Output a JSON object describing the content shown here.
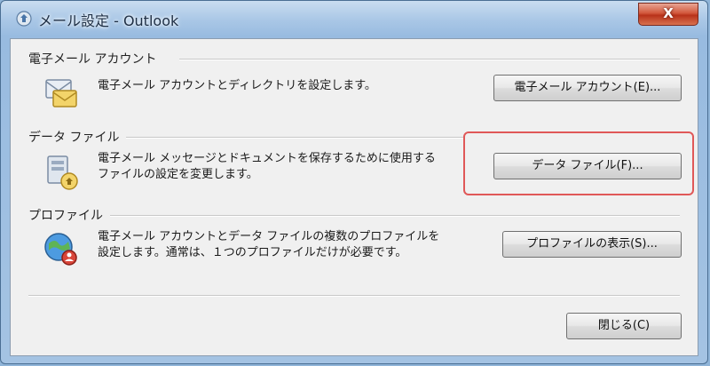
{
  "window": {
    "title": "メール設定 - Outlook",
    "close_label": "X"
  },
  "sections": {
    "accounts": {
      "label": "電子メール アカウント",
      "description": "電子メール アカウントとディレクトリを設定します。",
      "button_label": "電子メール アカウント(E)...",
      "icon": "mail-accounts-icon"
    },
    "data_files": {
      "label": "データ ファイル",
      "description_line1": "電子メール メッセージとドキュメントを保存するために使用する",
      "description_line2": "ファイルの設定を変更します。",
      "button_label": "データ ファイル(F)...",
      "icon": "data-file-icon",
      "highlight_color": "#e05858"
    },
    "profiles": {
      "label": "プロファイル",
      "description_line1": "電子メール アカウントとデータ ファイルの複数のプロファイルを",
      "description_line2": "設定します。通常は、１つのプロファイルだけが必要です。",
      "button_label": "プロファイルの表示(S)...",
      "icon": "profile-globe-icon"
    }
  },
  "footer": {
    "close_button_label": "閉じる(C)"
  }
}
